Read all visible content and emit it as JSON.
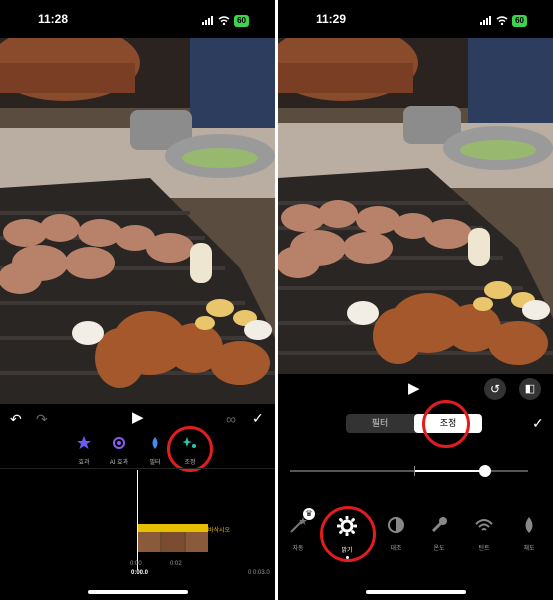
{
  "left": {
    "status": {
      "time": "11:28",
      "battery": "60"
    },
    "tools": [
      {
        "label": "효과",
        "icon": "star-icon",
        "color": "#6a5cf0"
      },
      {
        "label": "AI 효과",
        "icon": "ai-effect-icon",
        "color": "#8a5cf0"
      },
      {
        "label": "필터",
        "icon": "filter-icon",
        "color": "#3d8ef0"
      },
      {
        "label": "조정",
        "icon": "adjust-icon",
        "color": "#28c7a8"
      }
    ],
    "clip_caption": "바삭시오",
    "timeline": {
      "current": "0:00.0",
      "marks": [
        "0:00",
        "0:02",
        "0:03.0"
      ],
      "end_prefix": "0"
    }
  },
  "right": {
    "status": {
      "time": "11:29",
      "battery": "60"
    },
    "tabs": {
      "filter": "필터",
      "adjust": "조정"
    },
    "adjust_items": [
      {
        "label": "자동",
        "icon": "magic-wand-icon"
      },
      {
        "label": "밝기",
        "icon": "brightness-icon"
      },
      {
        "label": "대조",
        "icon": "contrast-icon"
      },
      {
        "label": "온도",
        "icon": "temperature-icon"
      },
      {
        "label": "틴트",
        "icon": "tint-icon"
      },
      {
        "label": "채도",
        "icon": "saturation-icon"
      }
    ],
    "slider_value": 0.82
  }
}
